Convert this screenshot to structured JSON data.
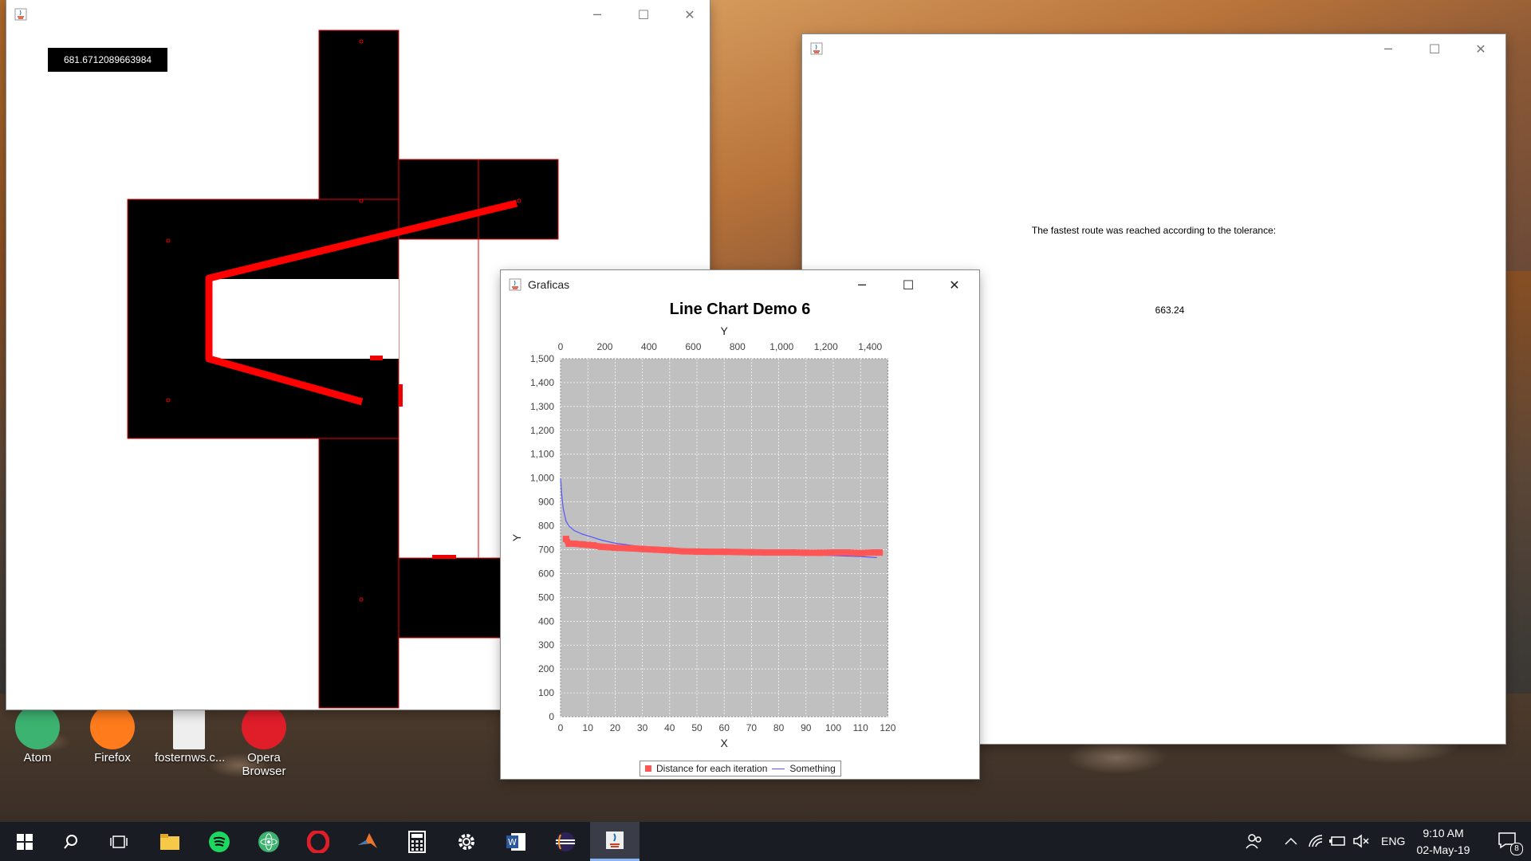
{
  "maze_window": {
    "distance_label": "681.6712089663984"
  },
  "result_window": {
    "message": "The fastest route was reached according to the tolerance:",
    "value": "663.24"
  },
  "chart_window": {
    "title": "Graficas",
    "controls": {
      "minimize": "─",
      "maximize": "☐",
      "close": "✕"
    }
  },
  "chart_data": {
    "type": "line",
    "title": "Line Chart Demo 6",
    "xlabel": "X",
    "ylabel": "Y",
    "top_axis_label": "Y",
    "xlim": [
      0,
      120
    ],
    "ylim": [
      0,
      1500
    ],
    "top_axis_range": [
      0,
      1480
    ],
    "x_ticks": [
      "0",
      "10",
      "20",
      "30",
      "40",
      "50",
      "60",
      "70",
      "80",
      "90",
      "100",
      "110",
      "120"
    ],
    "y_ticks": [
      "0",
      "100",
      "200",
      "300",
      "400",
      "500",
      "600",
      "700",
      "800",
      "900",
      "1,000",
      "1,100",
      "1,200",
      "1,300",
      "1,400",
      "1,500"
    ],
    "top_ticks": [
      "0",
      "200",
      "400",
      "600",
      "800",
      "1,000",
      "1,200",
      "1,400"
    ],
    "grid": true,
    "legend_position": "bottom",
    "series": [
      {
        "name": "Distance for each iteration",
        "color": "#ff5555",
        "style": "markers",
        "x": [
          2,
          3,
          5,
          8,
          10,
          12,
          15,
          18,
          20,
          25,
          30,
          35,
          40,
          45,
          50,
          55,
          60,
          65,
          70,
          75,
          80,
          85,
          90,
          95,
          100,
          105,
          110,
          115,
          117
        ],
        "y": [
          745,
          725,
          725,
          722,
          720,
          718,
          712,
          710,
          708,
          706,
          703,
          700,
          697,
          693,
          692,
          691,
          691,
          690,
          689,
          688,
          688,
          688,
          687,
          687,
          688,
          688,
          686,
          688,
          688
        ]
      },
      {
        "name": "Something",
        "color": "#5555ff",
        "style": "line",
        "x": [
          0,
          0.5,
          1,
          2,
          3,
          5,
          8,
          10,
          15,
          20,
          30,
          40,
          50,
          60,
          70,
          80,
          90,
          100,
          110,
          116
        ],
        "y": [
          1000,
          920,
          870,
          820,
          800,
          780,
          765,
          758,
          740,
          727,
          712,
          702,
          695,
          690,
          686,
          682,
          679,
          675,
          671,
          667
        ]
      }
    ]
  },
  "desktop_icons": [
    {
      "label": "Atom",
      "color": "#3cb371"
    },
    {
      "label": "Firefox",
      "color": "#ff7b1c"
    },
    {
      "label": "fosternws.c...",
      "color": "#eeeeee"
    },
    {
      "label": "Opera Browser",
      "color": "#e01e2a"
    }
  ],
  "taskbar": {
    "language": "ENG",
    "time": "9:10 AM",
    "date": "02-May-19",
    "notification_count": "8",
    "apps": [
      "start-icon",
      "search-icon",
      "task-view-icon",
      "file-explorer-icon",
      "spotify-icon",
      "atom-icon",
      "opera-icon",
      "matlab-icon",
      "calculator-icon",
      "settings-icon",
      "word-icon",
      "eclipse-icon",
      "java-icon"
    ]
  }
}
